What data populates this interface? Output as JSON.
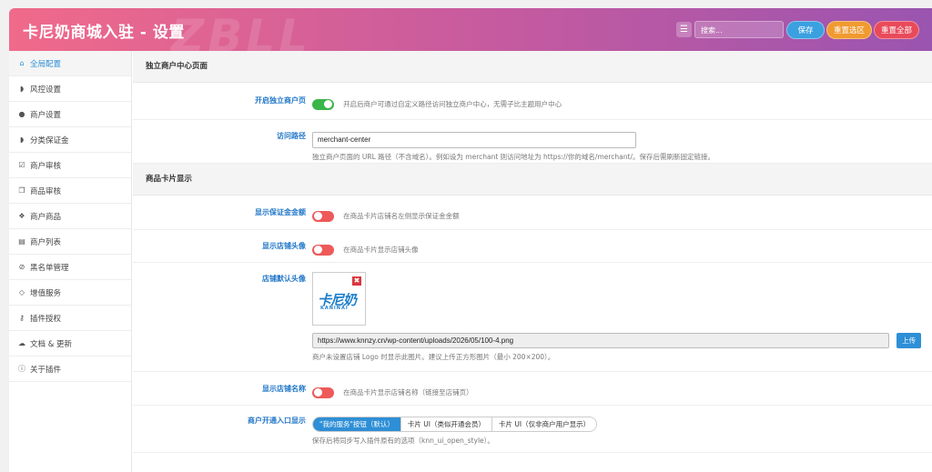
{
  "header": {
    "title": "卡尼奶商城入驻 - 设置",
    "watermark": "ZBLL",
    "search_placeholder": "搜索...",
    "save_label": "保存",
    "reset_section_label": "重置选区",
    "reset_all_label": "重置全部",
    "colors": {
      "save": "#3aa0e0",
      "reset_section": "#f09a30",
      "reset_all": "#e94a5a"
    }
  },
  "sidebar": {
    "items": [
      {
        "label": "全局配置",
        "icon": "home-icon",
        "active": true
      },
      {
        "label": "风控设置",
        "icon": "shield-icon"
      },
      {
        "label": "商户设置",
        "icon": "users-icon"
      },
      {
        "label": "分类保证金",
        "icon": "shield-icon"
      },
      {
        "label": "商户审核",
        "icon": "check-square-icon"
      },
      {
        "label": "商品审核",
        "icon": "copy-icon"
      },
      {
        "label": "商户商品",
        "icon": "cubes-icon"
      },
      {
        "label": "商户列表",
        "icon": "id-card-icon"
      },
      {
        "label": "黑名单管理",
        "icon": "ban-icon"
      },
      {
        "label": "增值服务",
        "icon": "diamond-icon"
      },
      {
        "label": "插件授权",
        "icon": "key-icon"
      },
      {
        "label": "文档 & 更新",
        "icon": "cloud-download-icon"
      },
      {
        "label": "关于插件",
        "icon": "info-icon"
      }
    ]
  },
  "sections": {
    "merchant_center": {
      "title": "独立商户中心页面",
      "enable": {
        "label": "开启独立商户页",
        "state": "on",
        "desc": "开启后商户可通过自定义路径访问独立商户中心，无需子比主题用户中心"
      },
      "path": {
        "label": "访问路径",
        "value": "merchant-center",
        "desc": "独立商户页面的 URL 路径（不含域名）。例如设为 merchant 则访问地址为 https://你的域名/merchant/。保存后需刷新固定链接。"
      }
    },
    "product_card": {
      "title": "商品卡片显示",
      "deposit": {
        "label": "显示保证金金额",
        "state": "off",
        "desc": "在商品卡片店铺名左侧显示保证金金额"
      },
      "avatar": {
        "label": "显示店铺头像",
        "state": "off",
        "desc": "在商品卡片显示店铺头像"
      },
      "default_avatar": {
        "label": "店铺默认头像",
        "logo_cn": "卡尼奶",
        "logo_en": "KANINAI",
        "remove": "✖",
        "url": "https://www.knnzy.cn/wp-content/uploads/2026/05/100-4.png",
        "upload_label": "上传",
        "desc": "商户未设置店铺 Logo 时显示此图片。建议上传正方形图片（最小 200×200）。"
      },
      "shop_name": {
        "label": "显示店铺名称",
        "state": "off",
        "desc": "在商品卡片显示店铺名称（链接至店铺页）"
      },
      "entry": {
        "label": "商户开通入口显示",
        "options": [
          "\"我的服务\"按钮（默认）",
          "卡片 UI（类似开通会员）",
          "卡片 UI（仅非商户用户显示）"
        ],
        "selected": 0,
        "desc": "保存后将同步写入插件原有的选项（knn_ui_open_style）。"
      }
    }
  },
  "colors": {
    "accent": "#2e8fd6",
    "toggle_on": "#3ab54a",
    "toggle_off": "#ee5a5a",
    "label": "#2478c8"
  }
}
